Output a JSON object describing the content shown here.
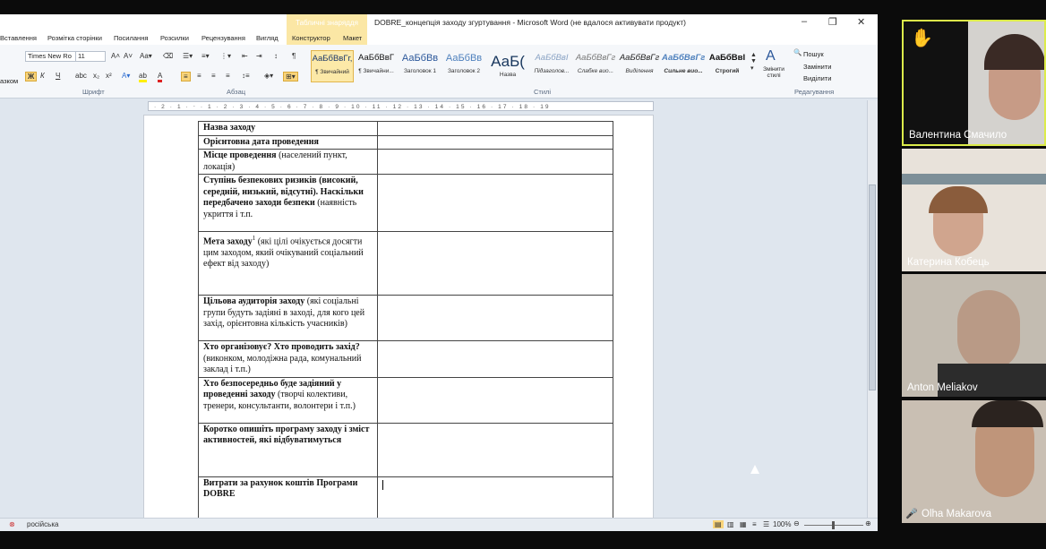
{
  "window": {
    "title": "DOBRE_концепція заходу згуртування  -  Microsoft Word (не вдалося активувати продукт)",
    "context_tab": "Табличні знаряддя",
    "minimize": "–",
    "maximize": "❐",
    "close": "✕"
  },
  "tabs": [
    "Вставлення",
    "Розмітка сторінки",
    "Посилання",
    "Розсилки",
    "Рецензування",
    "Вигляд",
    "Конструктор",
    "Макет"
  ],
  "ribbon": {
    "font_name": "Times New Ro",
    "font_size": "11",
    "left_cut": "азком",
    "groups": {
      "font": "Шрифт",
      "paragraph": "Абзац",
      "styles": "Стилі",
      "editing": "Редагування"
    },
    "styles": [
      {
        "preview": "АаБбВвГг,",
        "name": "¶ Звичайний"
      },
      {
        "preview": "АаБбВвГ",
        "name": "¶ Звичайни..."
      },
      {
        "preview": "АаБбВв",
        "name": "Заголовок 1"
      },
      {
        "preview": "АаБбВв",
        "name": "Заголовок 2"
      },
      {
        "preview": "АаБ(",
        "name": "Назва"
      },
      {
        "preview": "АаБбВвІ",
        "name": "Підзаголов..."
      },
      {
        "preview": "АаБбВвГг",
        "name": "Слабке вио..."
      },
      {
        "preview": "АаБбВвГг",
        "name": "Виділення"
      },
      {
        "preview": "АаБбВвГг",
        "name": "Сильне вио..."
      },
      {
        "preview": "АаБбВвІ",
        "name": "Строгий"
      }
    ],
    "change_styles": "Змінити стилі",
    "editing": {
      "find": "Пошук",
      "replace": "Замінити",
      "select": "Виділити"
    }
  },
  "ruler_marks": "· 2 · 1 · ⋅ · 1 · 2 · 3 · 4 · 5 · 6 · 7 · 8 · 9 · 10 · 11 · 12 · 13 · 14 · 15 · 16 · 17 · 18 · 19",
  "table": [
    {
      "label_bold": "Назва заходу",
      "label_rest": ""
    },
    {
      "label_bold": "Орієнтовна дата проведення",
      "label_rest": ""
    },
    {
      "label_bold": "Місце проведення",
      "label_rest": " (населений пункт, локація)"
    },
    {
      "label_bold": "Ступінь безпекових ризиків (високий, середній, низький, відсутні). Наскільки передбачено заходи безпеки",
      "label_rest": " (наявність укриття і т.п."
    },
    {
      "label_bold": "Мета заходу",
      "label_sup": "1",
      "label_rest": " (які цілі очікується досягти цим заходом, який очікуваний соціальний ефект від заходу)"
    },
    {
      "label_bold": "Цільова аудиторія заходу",
      "label_rest": " (які соціальні групи будуть задіяні в заході, для кого цей захід, орієнтовна кількість учасників)"
    },
    {
      "label_bold": "Хто організовує? Хто проводить захід?",
      "label_rest": " (виконком, молодіжна рада, комунальний заклад і т.п.)"
    },
    {
      "label_bold": "Хто безпосередньо буде задіяний у проведенні заходу",
      "label_rest": " (творчі колективи, тренери, консультанти, волонтери і т.п.)"
    },
    {
      "label_bold": "Коротко опишіть програму заходу і зміст активностей, які відбуватимуться",
      "label_rest": ""
    },
    {
      "label_bold": "Витрати за рахунок коштів Програми DOBRE",
      "label_rest": ""
    }
  ],
  "status": {
    "language": "російська",
    "zoom": "100%"
  },
  "participants": [
    {
      "name": "Валентина Смачило",
      "hand": "✋"
    },
    {
      "name": "Катерина Кобець"
    },
    {
      "name": "Anton Meliakov"
    },
    {
      "name": "Olha Makarova",
      "muted": "🎤"
    }
  ]
}
